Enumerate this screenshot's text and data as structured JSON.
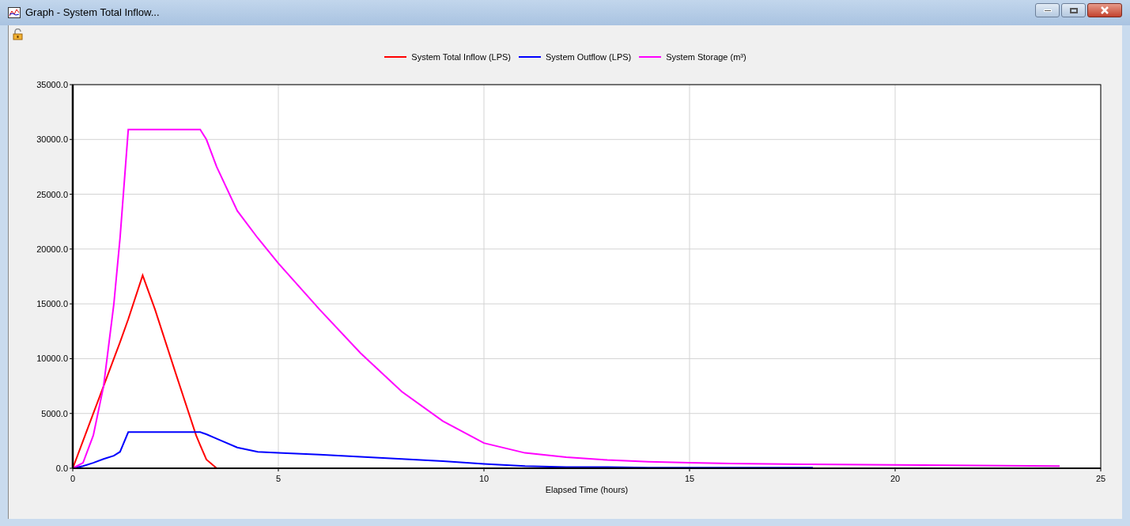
{
  "window": {
    "title": "Graph - System Total Inflow..."
  },
  "chart": {
    "chart_data": {
      "type": "line",
      "grid": true,
      "xlabel": "Elapsed Time (hours)",
      "xlim": [
        0,
        25
      ],
      "ylim": [
        0,
        35000
      ],
      "xticks": [
        0,
        5,
        10,
        15,
        20,
        25
      ],
      "yticks": [
        {
          "value": 0,
          "label": "0.0"
        },
        {
          "value": 5000,
          "label": "5000.0"
        },
        {
          "value": 10000,
          "label": "10000.0"
        },
        {
          "value": 15000,
          "label": "15000.0"
        },
        {
          "value": 20000,
          "label": "20000.0"
        },
        {
          "value": 25000,
          "label": "25000.0"
        },
        {
          "value": 30000,
          "label": "30000.0"
        },
        {
          "value": 35000,
          "label": "35000.0"
        }
      ],
      "x": [
        0,
        0.25,
        0.5,
        0.75,
        1,
        1.15,
        1.35,
        1.7,
        2,
        2.5,
        3,
        3.1,
        3.25,
        3.5,
        4,
        4.5,
        5,
        6,
        7,
        8,
        9,
        10,
        11,
        12,
        13,
        14,
        15,
        16,
        18,
        20,
        22,
        24
      ],
      "series": [
        {
          "name": "System Total Inflow (LPS)",
          "color": "#ff0000",
          "values": [
            0,
            2500,
            5000,
            7500,
            10000,
            11500,
            13600,
            17600,
            14500,
            8700,
            3000,
            2100,
            800,
            0,
            null,
            null,
            null,
            null,
            null,
            null,
            null,
            null,
            null,
            null,
            null,
            null,
            null,
            null,
            null,
            null,
            null,
            null
          ]
        },
        {
          "name": "System Outflow (LPS)",
          "color": "#0000ff",
          "values": [
            0,
            200,
            500,
            850,
            1150,
            1500,
            3300,
            3300,
            3300,
            3300,
            3300,
            3300,
            3100,
            2700,
            1900,
            1500,
            1400,
            1250,
            1050,
            850,
            650,
            400,
            200,
            100,
            100,
            50,
            50,
            50,
            50,
            null,
            null,
            null
          ]
        },
        {
          "name": "System Storage (m³)",
          "color": "#ff00ff",
          "values": [
            0,
            500,
            3000,
            7500,
            15000,
            21000,
            30900,
            30900,
            30900,
            30900,
            30900,
            30900,
            30000,
            27500,
            23500,
            21000,
            18700,
            14500,
            10500,
            7000,
            4300,
            2300,
            1400,
            1000,
            750,
            600,
            500,
            430,
            350,
            300,
            250,
            200
          ]
        }
      ]
    }
  }
}
